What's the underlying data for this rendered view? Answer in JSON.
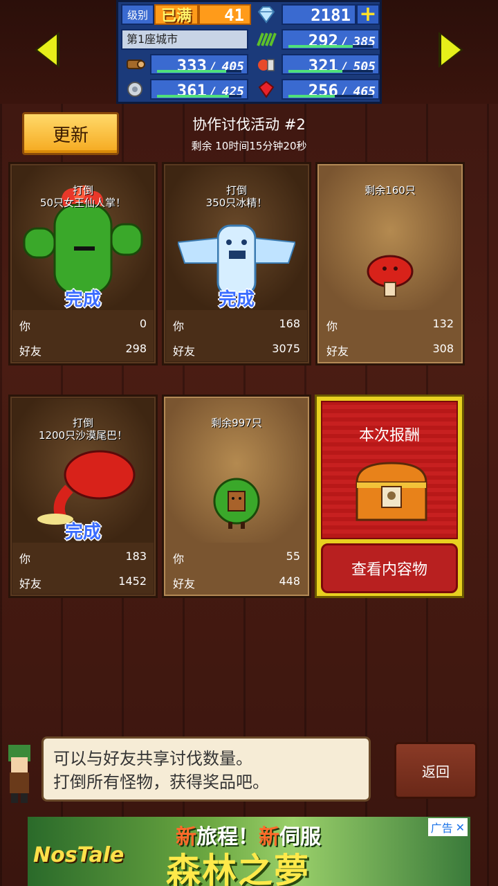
{
  "status": {
    "level_label": "级别",
    "level_badge": "已满",
    "level_value": "41",
    "gems": "2181",
    "plus_label": "+",
    "city": "第1座城市",
    "resources": {
      "grass": {
        "value": "292",
        "sep": "/",
        "max": "385"
      },
      "wood": {
        "value": "333",
        "sep": "/",
        "max": "405"
      },
      "food": {
        "value": "321",
        "sep": "/",
        "max": "505"
      },
      "stone": {
        "value": "361",
        "sep": "/",
        "max": "425"
      },
      "ruby": {
        "value": "256",
        "sep": "/",
        "max": "465"
      }
    }
  },
  "header": {
    "update_label": "更新",
    "title": "协作讨伐活动 #2",
    "timer": "剩余 10时间15分钟20秒"
  },
  "cards": [
    {
      "caption_l1": "打倒",
      "caption_l2": "50只女王仙人掌！",
      "done": "完成",
      "you_label": "你",
      "you": "0",
      "friend_label": "好友",
      "friend": "298"
    },
    {
      "caption_l1": "打倒",
      "caption_l2": "350只冰精！",
      "done": "完成",
      "you_label": "你",
      "you": "168",
      "friend_label": "好友",
      "friend": "3075"
    },
    {
      "caption_l1": "剩余160只",
      "you_label": "你",
      "you": "132",
      "friend_label": "好友",
      "friend": "308"
    },
    {
      "caption_l1": "打倒",
      "caption_l2": "1200只沙漠尾巴！",
      "done": "完成",
      "you_label": "你",
      "you": "183",
      "friend_label": "好友",
      "friend": "1452"
    },
    {
      "caption_l1": "剩余997只",
      "you_label": "你",
      "you": "55",
      "friend_label": "好友",
      "friend": "448"
    }
  ],
  "reward": {
    "title": "本次报酬",
    "button": "查看内容物"
  },
  "dialog": {
    "line1": "可以与好友共享讨伐数量。",
    "line2": "打倒所有怪物，获得奖品吧。"
  },
  "back_label": "返回",
  "ad": {
    "logo": "NosTale",
    "line1_a": "新",
    "line1_b": "旅程！",
    "line1_c": "新",
    "line1_d": "伺服",
    "line2": "森林之夢",
    "tag": "广告",
    "close": "✕"
  },
  "colors": {
    "accent_yellow": "#ffd96a",
    "done_blue": "#3a6cff",
    "reward_red": "#b82020"
  }
}
